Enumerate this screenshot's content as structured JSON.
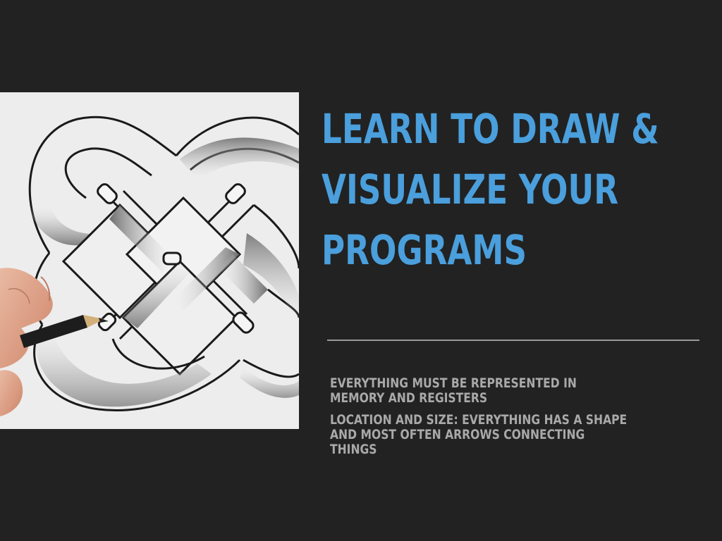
{
  "slide": {
    "title_lines": [
      "LEARN TO DRAW &",
      "VISUALIZE YOUR",
      "PROGRAMS"
    ],
    "bullets": [
      {
        "lines": [
          "EVERYTHING MUST BE REPRESENTED IN",
          "MEMORY AND REGISTERS"
        ]
      },
      {
        "lines": [
          "LOCATION AND SIZE:  EVERYTHING HAS A SHAPE",
          "AND MOST OFTEN ARROWS CONNECTING",
          "THINGS"
        ]
      }
    ]
  },
  "colors": {
    "background": "#222222",
    "title": "#4a9fdc",
    "body_text": "#a9a9a9",
    "divider": "#9a9a9a"
  },
  "image": {
    "subject": "pencil-drawn-celtic-knot-with-hand-holding-pencil"
  }
}
